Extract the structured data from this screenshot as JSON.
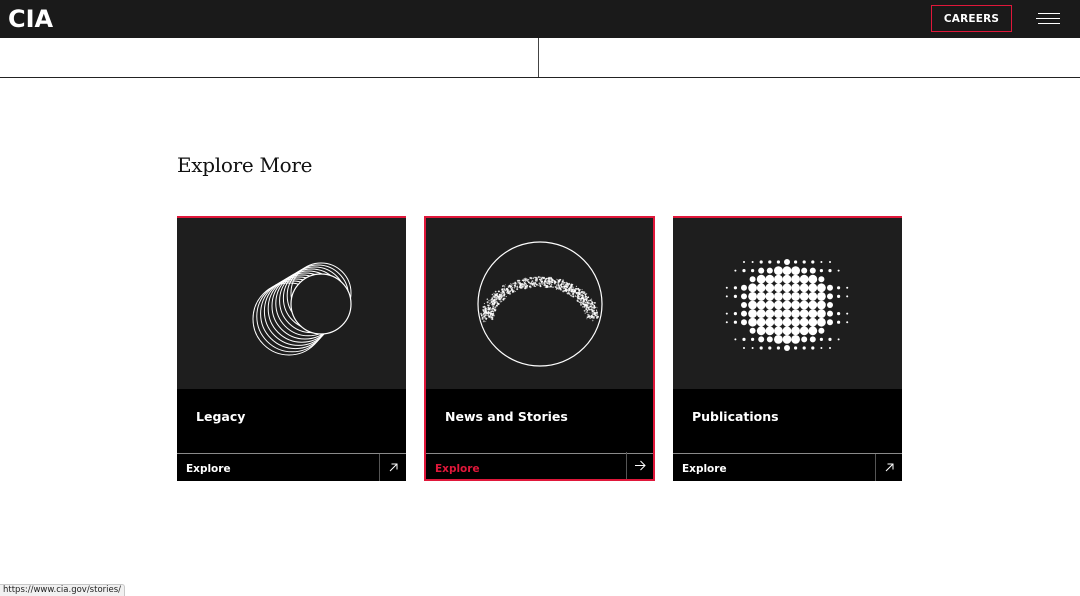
{
  "header": {
    "logo": "CIA",
    "careers_label": "CAREERS",
    "menu_icon": "hamburger-menu-icon"
  },
  "section": {
    "heading": "Explore More"
  },
  "cards": [
    {
      "title": "Legacy",
      "link_label": "Explore",
      "icon": "arrow-up-right-icon",
      "art": "overlapping-circles-graphic"
    },
    {
      "title": "News and Stories",
      "link_label": "Explore",
      "icon": "arrow-right-icon",
      "art": "eclipse-crescent-graphic",
      "active": true
    },
    {
      "title": "Publications",
      "link_label": "Explore",
      "icon": "arrow-up-right-icon",
      "art": "halftone-dots-graphic"
    }
  ],
  "status_bar": {
    "url": "https://www.cia.gov/stories/"
  },
  "colors": {
    "accent": "#e0173a",
    "topbar_bg": "#1a1a1a",
    "card_art_bg": "#1e1e1e",
    "card_bg": "#000000"
  }
}
